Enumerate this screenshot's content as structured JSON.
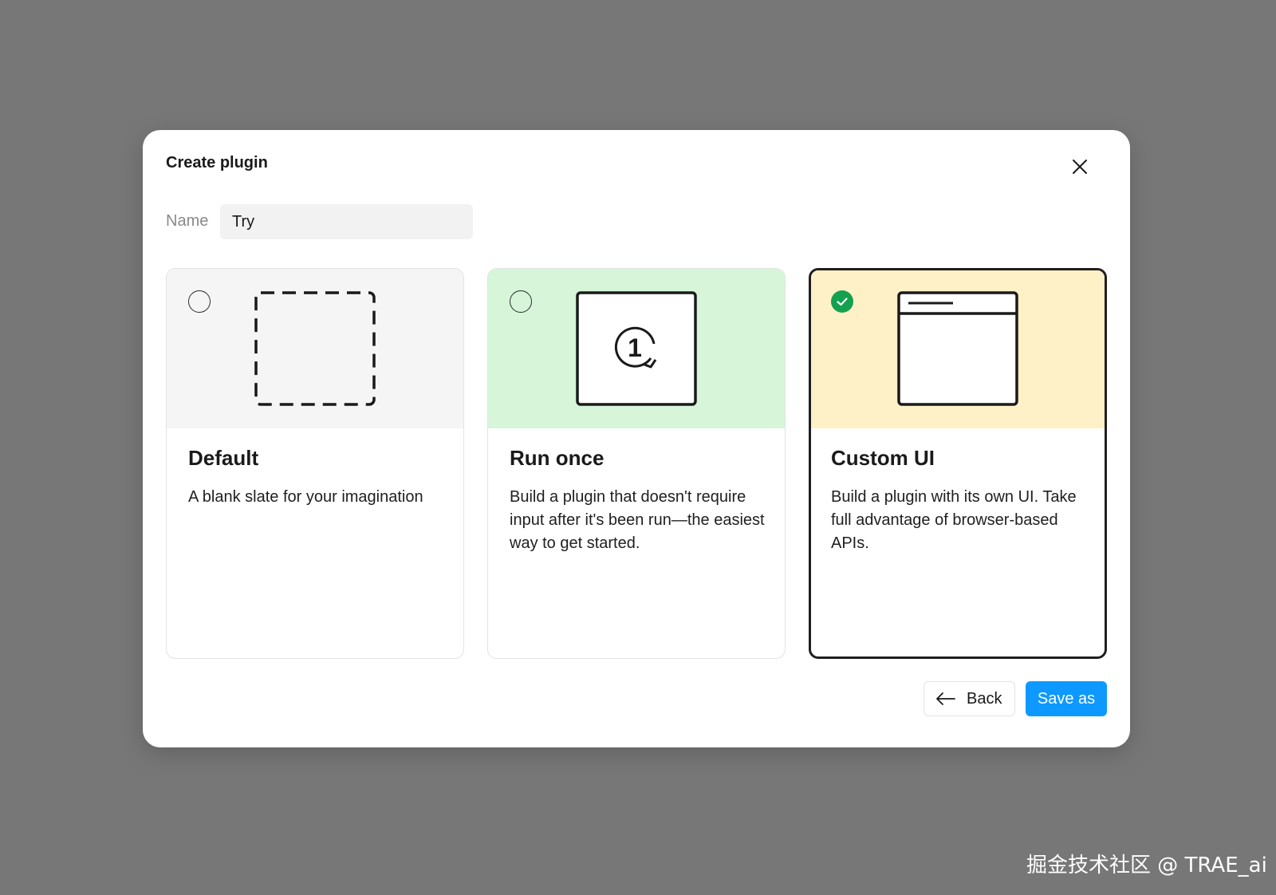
{
  "dialog": {
    "title": "Create plugin",
    "close_icon": "close-icon"
  },
  "name_field": {
    "label": "Name",
    "value": "Try"
  },
  "cards": [
    {
      "title": "Default",
      "description": "A blank slate for your imagination",
      "selected": false,
      "top_color": "#f5f5f5",
      "illustration": "dashed-square-icon"
    },
    {
      "title": "Run once",
      "description": "Build a plugin that doesn't require input after it's been run—the easiest way to get started.",
      "selected": false,
      "top_color": "#d6f5d9",
      "illustration": "run-once-icon",
      "illustration_text": "1"
    },
    {
      "title": "Custom UI",
      "description": "Build a plugin with its own UI. Take full advantage of browser-based APIs.",
      "selected": true,
      "top_color": "#fef0c7",
      "illustration": "window-icon"
    }
  ],
  "footer": {
    "back_label": "Back",
    "save_label": "Save as"
  },
  "colors": {
    "accent": "#0d99ff",
    "selected_check": "#14a14f"
  },
  "watermark": "掘金技术社区 @ TRAE_ai"
}
